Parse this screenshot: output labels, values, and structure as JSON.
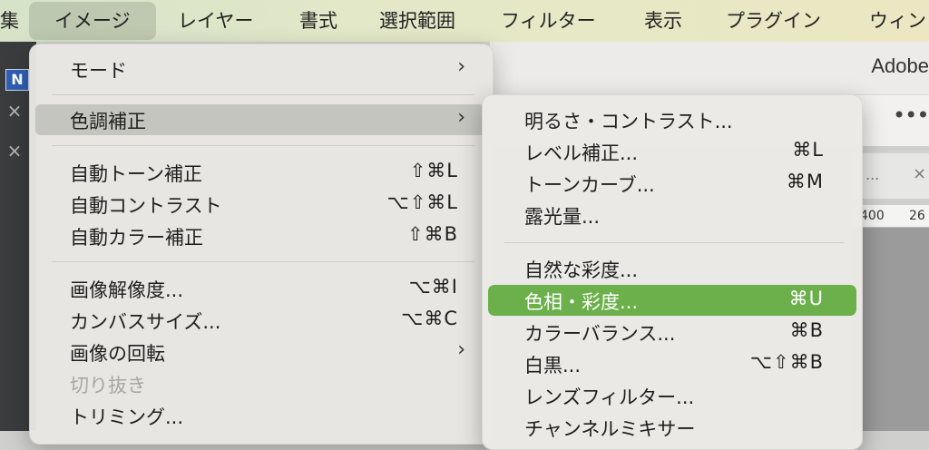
{
  "menubar": {
    "items": [
      "集",
      "イメージ",
      "レイヤー",
      "書式",
      "選択範囲",
      "フィルター",
      "表示",
      "プラグイン",
      "ウィン"
    ]
  },
  "app": {
    "title": "Adobe",
    "n_button": "N",
    "toolbar_more": "•••",
    "tab_dots": "...",
    "ruler": [
      "400",
      "26"
    ]
  },
  "image_menu": {
    "items": [
      {
        "label": "モード",
        "submenu": true
      },
      {
        "label": "色調補正",
        "submenu": true
      },
      {
        "label": "自動トーン補正",
        "shortcut": "⇧⌘L"
      },
      {
        "label": "自動コントラスト",
        "shortcut": "⌥⇧⌘L"
      },
      {
        "label": "自動カラー補正",
        "shortcut": "⇧⌘B"
      },
      {
        "label": "画像解像度...",
        "shortcut": "⌥⌘I"
      },
      {
        "label": "カンバスサイズ...",
        "shortcut": "⌥⌘C"
      },
      {
        "label": "画像の回転",
        "submenu": true
      },
      {
        "label": "切り抜き"
      },
      {
        "label": "トリミング..."
      }
    ],
    "arrow": "›"
  },
  "adjustments_submenu": {
    "items": [
      {
        "label": "明るさ・コントラスト..."
      },
      {
        "label": "レベル補正...",
        "shortcut": "⌘L"
      },
      {
        "label": "トーンカーブ...",
        "shortcut": "⌘M"
      },
      {
        "label": "露光量..."
      },
      {
        "label": "自然な彩度..."
      },
      {
        "label": "色相・彩度...",
        "shortcut": "⌘U"
      },
      {
        "label": "カラーバランス...",
        "shortcut": "⌘B"
      },
      {
        "label": "白黒...",
        "shortcut": "⌥⇧⌘B"
      },
      {
        "label": "レンズフィルター..."
      },
      {
        "label": "チャンネルミキサー"
      }
    ]
  },
  "colors": {
    "highlight_green": "#6bb04a",
    "highlight_gray": "#bebeba"
  }
}
